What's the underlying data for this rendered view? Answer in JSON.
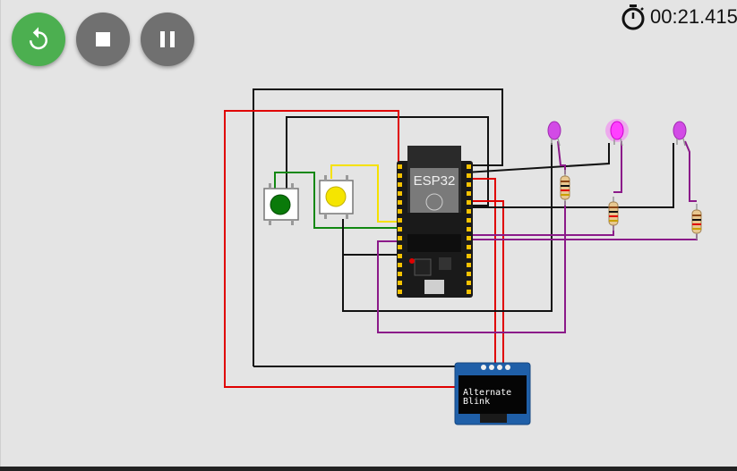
{
  "toolbar": {
    "restart_icon": "restart-icon",
    "stop_icon": "stop-icon",
    "pause_icon": "pause-icon",
    "restart_color": "#4caf50",
    "button_color": "#707070"
  },
  "timer": {
    "icon": "stopwatch-icon",
    "elapsed": "00:21.415"
  },
  "board": {
    "label": "ESP32"
  },
  "display": {
    "line1": "Alternate",
    "line2": "Blink"
  },
  "buttons": [
    {
      "color": "#0a7a0a",
      "name": "green"
    },
    {
      "color": "#f5e500",
      "name": "yellow"
    }
  ],
  "leds": [
    {
      "color": "#d24be6",
      "lit": false
    },
    {
      "color": "#ff40ff",
      "lit": true
    },
    {
      "color": "#d24be6",
      "lit": false
    }
  ],
  "wire_colors": {
    "red": "#e00000",
    "black": "#111111",
    "green": "#118811",
    "yellow": "#f5e100",
    "purple": "#8b1a89"
  }
}
